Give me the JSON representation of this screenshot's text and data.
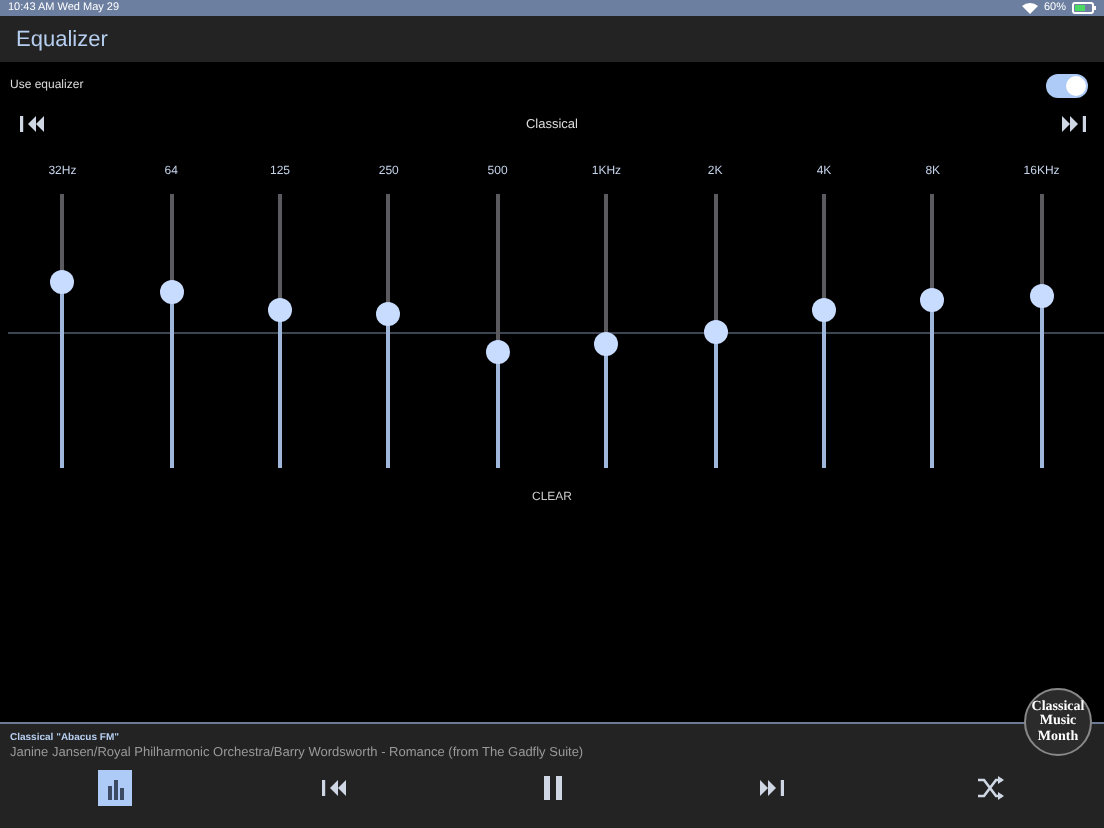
{
  "status_bar": {
    "time": "10:43 AM  Wed May 29",
    "battery": "60%"
  },
  "header": {
    "title": "Equalizer"
  },
  "use_equalizer": {
    "label": "Use equalizer",
    "on": true
  },
  "preset": {
    "name": "Classical"
  },
  "bands": [
    {
      "label": "32Hz",
      "level": 0.68
    },
    {
      "label": "64",
      "level": 0.64
    },
    {
      "label": "125",
      "level": 0.58
    },
    {
      "label": "250",
      "level": 0.56
    },
    {
      "label": "500",
      "level": 0.42
    },
    {
      "label": "1KHz",
      "level": 0.45
    },
    {
      "label": "2K",
      "level": 0.5
    },
    {
      "label": "4K",
      "level": 0.58
    },
    {
      "label": "8K",
      "level": 0.61
    },
    {
      "label": "16KHz",
      "level": 0.63
    }
  ],
  "clear_button": "CLEAR",
  "now_playing": {
    "station": "Classical \"Abacus FM\"",
    "track": "Janine Jansen/Royal Philharmonic Orchestra/Barry Wordsworth - Romance (from The Gadfly Suite)",
    "logo": "Classical Music Month"
  },
  "controls": [
    {
      "kind": "equalizer",
      "selected": true
    },
    {
      "kind": "previous",
      "selected": false
    },
    {
      "kind": "pause",
      "selected": false
    },
    {
      "kind": "next",
      "selected": false
    },
    {
      "kind": "shuffle",
      "selected": false
    }
  ]
}
